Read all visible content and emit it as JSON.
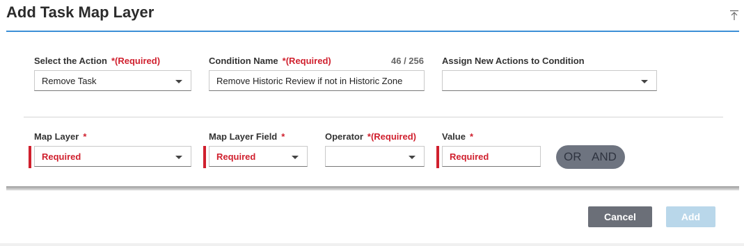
{
  "header": {
    "title": "Add Task Map Layer",
    "collapse_icon": "collapse-to-top-icon"
  },
  "row1": {
    "action": {
      "label": "Select the Action",
      "required_text": "*(Required)",
      "value": "Remove Task"
    },
    "condition": {
      "label": "Condition Name",
      "required_text": "*(Required)",
      "counter": "46 / 256",
      "value": "Remove Historic Review if not in Historic Zone"
    },
    "assign": {
      "label": "Assign New Actions to Condition",
      "value": ""
    }
  },
  "row2": {
    "map_layer": {
      "label": "Map Layer",
      "star": "*",
      "value": "Required"
    },
    "map_layer_field": {
      "label": "Map Layer Field",
      "star": "*",
      "value": "Required"
    },
    "operator": {
      "label": "Operator",
      "required_text": "*(Required)",
      "value": ""
    },
    "value": {
      "label": "Value",
      "star": "*",
      "value": "Required"
    },
    "logic_toggle": {
      "or_label": "OR",
      "and_label": "AND"
    }
  },
  "footer": {
    "cancel_label": "Cancel",
    "add_label": "Add"
  },
  "colors": {
    "accent": "#3b8fd6",
    "required": "#d0202e",
    "cancel_bg": "#6b6f78",
    "add_disabled_bg": "#b9d7ea"
  }
}
